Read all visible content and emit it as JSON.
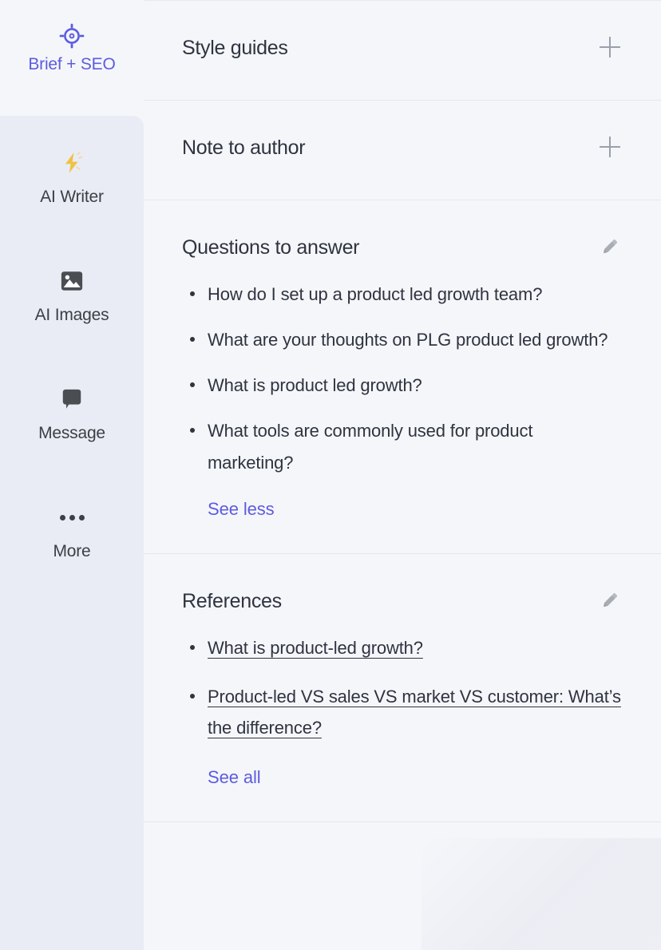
{
  "colors": {
    "accent": "#5c5ce0",
    "text": "#2e3440",
    "muted": "#9aa0ab",
    "sidebar_panel": "#e9ecf5",
    "page_bg": "#f5f6fa",
    "bolt_yellow": "#f0c244"
  },
  "sidebar": {
    "brand": {
      "label": "Brief + SEO",
      "icon": "target-crosshair-icon"
    },
    "items": [
      {
        "label": "AI Writer",
        "icon": "lightning-bolt-icon",
        "active": true
      },
      {
        "label": "AI Images",
        "icon": "image-icon",
        "active": false
      },
      {
        "label": "Message",
        "icon": "speech-bubble-icon",
        "active": false
      },
      {
        "label": "More",
        "icon": "ellipsis-icon",
        "active": false
      }
    ]
  },
  "main": {
    "sections": [
      {
        "id": "style-guides",
        "title": "Style guides",
        "action_icon": "plus-icon",
        "items": [],
        "see_link": null
      },
      {
        "id": "note-to-author",
        "title": "Note to author",
        "action_icon": "plus-icon",
        "items": [],
        "see_link": null
      },
      {
        "id": "questions-to-answer",
        "title": "Questions to answer",
        "action_icon": "pencil-icon",
        "items": [
          "How do I set up a product led growth team?",
          "What are your thoughts on PLG product led growth?",
          "What is product led growth?",
          "What tools are commonly used for product marketing?"
        ],
        "see_link": "See less"
      },
      {
        "id": "references",
        "title": "References",
        "action_icon": "pencil-icon",
        "items": [
          "What is product-led growth?",
          "Product-led VS sales VS market VS customer: What’s the difference?"
        ],
        "see_link": "See all"
      }
    ]
  }
}
